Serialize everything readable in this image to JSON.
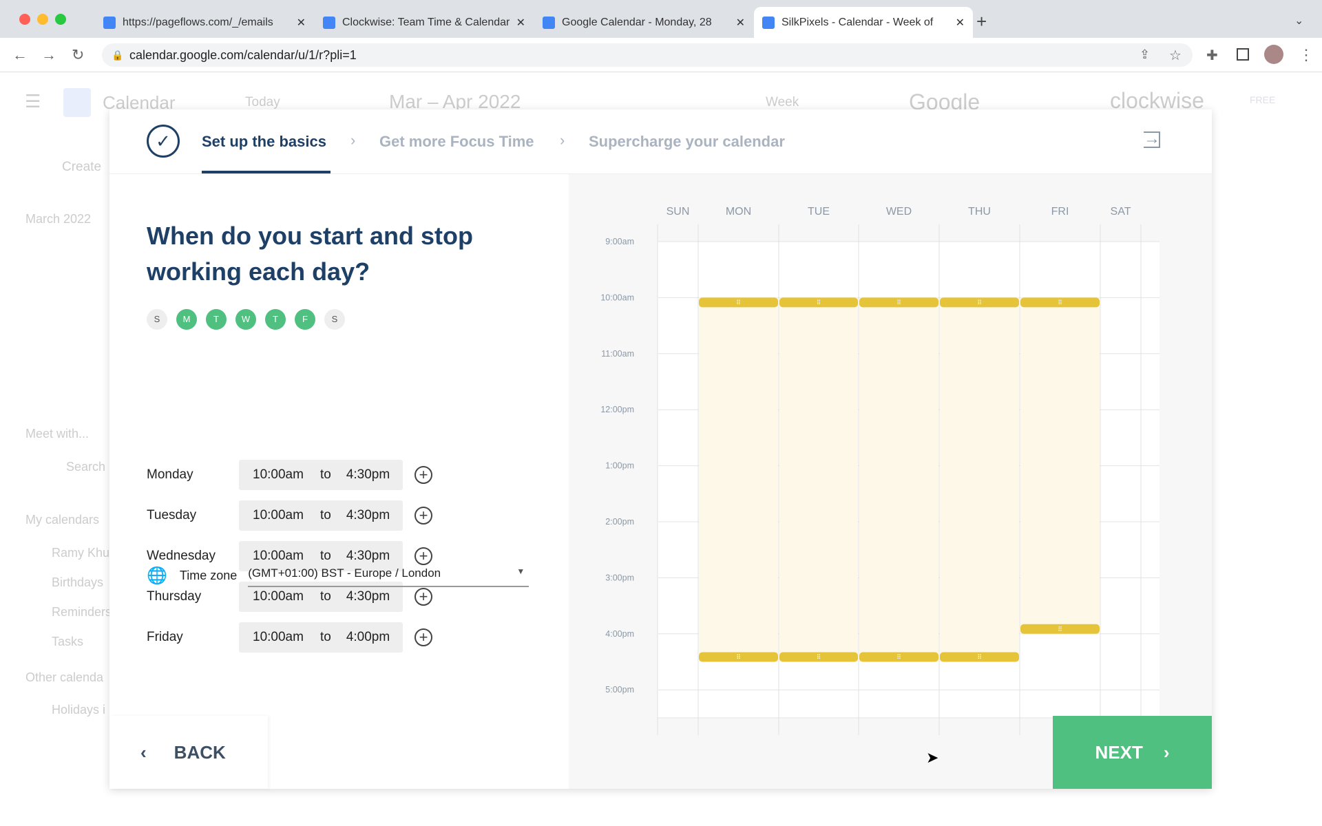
{
  "browser": {
    "tabs": [
      {
        "title": "https://pageflows.com/_/emails",
        "icon": "globe-icon"
      },
      {
        "title": "Clockwise: Team Time & Calendar",
        "icon": "clockwise-icon"
      },
      {
        "title": "Google Calendar - Monday, 28",
        "icon": "google-calendar-icon"
      },
      {
        "title": "SilkPixels - Calendar - Week of",
        "icon": "google-calendar-icon",
        "active": true
      }
    ],
    "url": "calendar.google.com/calendar/u/1/r?pli=1"
  },
  "background_app": {
    "app": "Calendar",
    "today": "Today",
    "range": "Mar – Apr 2022",
    "view": "Week",
    "brand": "Google",
    "clockwise": "clockwise",
    "badge": "FREE",
    "create": "Create",
    "month": "March 2022",
    "meet": "Meet with...",
    "search": "Search",
    "my_calendars": "My calendars",
    "calendars": [
      "Ramy Khu",
      "Birthdays",
      "Reminders",
      "Tasks"
    ],
    "other": "Other calenda",
    "holidays": "Holidays i"
  },
  "steps": [
    {
      "label": "Set up the basics",
      "active": true
    },
    {
      "label": "Get more Focus Time"
    },
    {
      "label": "Supercharge your calendar"
    }
  ],
  "question": "When do you start and stop working each day?",
  "weekdays": [
    {
      "l": "S",
      "on": false
    },
    {
      "l": "M",
      "on": true
    },
    {
      "l": "T",
      "on": true
    },
    {
      "l": "W",
      "on": true
    },
    {
      "l": "T",
      "on": true
    },
    {
      "l": "F",
      "on": true
    },
    {
      "l": "S",
      "on": false
    }
  ],
  "hours": [
    {
      "day": "Monday",
      "start": "10:00am",
      "to": "to",
      "end": "4:30pm"
    },
    {
      "day": "Tuesday",
      "start": "10:00am",
      "to": "to",
      "end": "4:30pm"
    },
    {
      "day": "Wednesday",
      "start": "10:00am",
      "to": "to",
      "end": "4:30pm"
    },
    {
      "day": "Thursday",
      "start": "10:00am",
      "to": "to",
      "end": "4:30pm"
    },
    {
      "day": "Friday",
      "start": "10:00am",
      "to": "to",
      "end": "4:00pm"
    }
  ],
  "timezone": {
    "label": "Time zone",
    "value": "(GMT+01:00) BST - Europe / London"
  },
  "calendar": {
    "days": [
      "SUN",
      "MON",
      "TUE",
      "WED",
      "THU",
      "FRI",
      "SAT"
    ],
    "times": [
      "9:00am",
      "10:00am",
      "11:00am",
      "12:00pm",
      "1:00pm",
      "2:00pm",
      "3:00pm",
      "4:00pm",
      "5:00pm"
    ],
    "blocks": [
      {
        "day": 1,
        "start": 10,
        "end": 16.5
      },
      {
        "day": 2,
        "start": 10,
        "end": 16.5
      },
      {
        "day": 3,
        "start": 10,
        "end": 16.5
      },
      {
        "day": 4,
        "start": 10,
        "end": 16.5
      },
      {
        "day": 5,
        "start": 10,
        "end": 16
      }
    ],
    "block_color": "#e6c43a",
    "block_fill": "#fdf8e8"
  },
  "buttons": {
    "back": "BACK",
    "next": "NEXT"
  },
  "colors": {
    "accent": "#4fc07f",
    "navy": "#1e3f66"
  }
}
